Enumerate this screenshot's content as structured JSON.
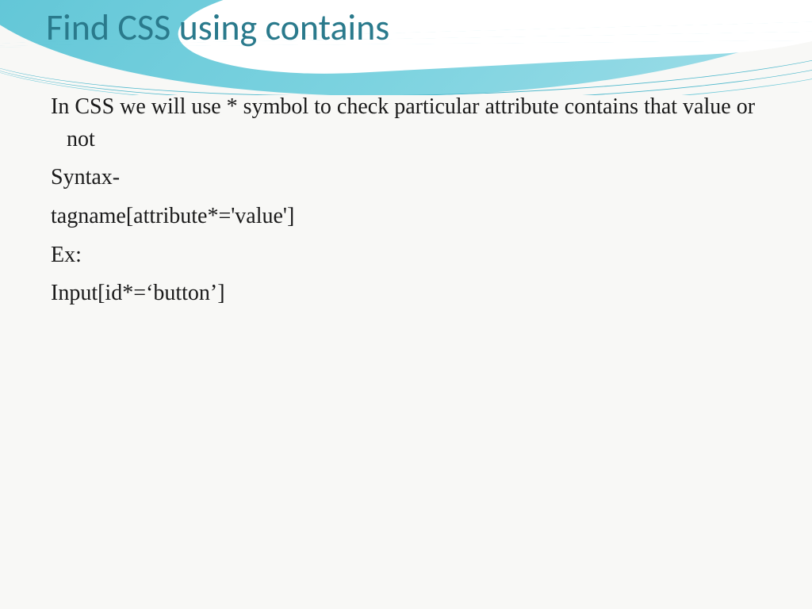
{
  "slide": {
    "title": "Find CSS using contains",
    "body": {
      "p1": "In CSS we will use * symbol to check particular attribute contains that value or not",
      "p2": "Syntax-",
      "p3": "tagname[attribute*='value']",
      "p4": "Ex:",
      "p5": "Input[id*=‘button’]"
    }
  }
}
